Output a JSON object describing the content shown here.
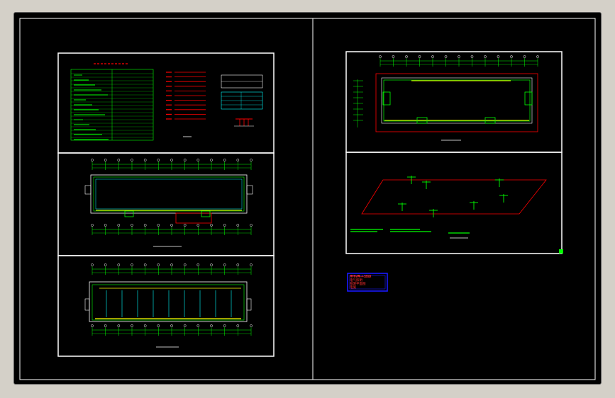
{
  "drawing": {
    "stamp_lines": [
      "某机械工业园",
      "电气照明",
      "照明平面图",
      "电施"
    ],
    "colors": {
      "background": "#000000",
      "border": "#ffffff",
      "layer_green": "#00ff00",
      "layer_red": "#ff0000",
      "layer_cyan": "#00ffff",
      "layer_yellow": "#ffff00",
      "stamp_blue": "#1a1aff"
    },
    "icons": [
      "cad-frame-border",
      "dimension-ticks",
      "column-grid-bubbles",
      "title-stamp"
    ]
  }
}
